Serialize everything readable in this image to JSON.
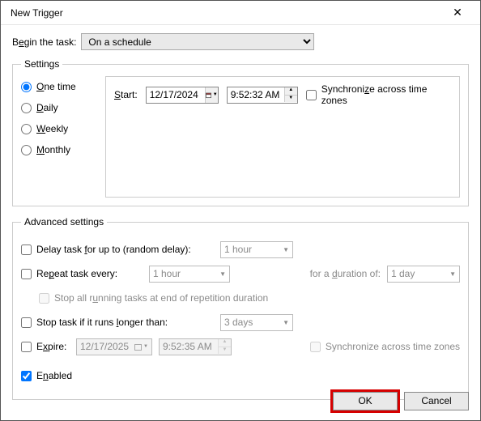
{
  "title": "New Trigger",
  "beginLabelPre": "B",
  "beginLabelU": "e",
  "beginLabelPost": "gin the task:",
  "beginValue": "On a schedule",
  "settingsLegend": "Settings",
  "radios": {
    "once": {
      "u": "O",
      "rest": "ne time"
    },
    "daily": {
      "u": "D",
      "rest": "aily"
    },
    "weekly": {
      "u": "W",
      "rest": "eekly"
    },
    "monthly": {
      "u": "M",
      "rest": "onthly"
    }
  },
  "startLabel": {
    "u": "S",
    "rest": "tart:"
  },
  "startDate": "12/17/2024",
  "startTime": "9:52:32 AM",
  "syncLabel": {
    "pre": "Synchroni",
    "u": "z",
    "post": "e across time zones"
  },
  "advLegend": "Advanced settings",
  "delay": {
    "pre": "Delay task ",
    "u": "f",
    "post": "or up to (random delay):",
    "value": "1 hour"
  },
  "repeat": {
    "pre": "Re",
    "u": "p",
    "post": "eat task every:",
    "value": "1 hour",
    "durLabelPre": "for a ",
    "durLabelU": "d",
    "durLabelPost": "uration of:",
    "durValue": "1 day"
  },
  "stopAllPre": "Stop all r",
  "stopAllU": "u",
  "stopAllPost": "nning tasks at end of repetition duration",
  "stopLong": {
    "pre": "Stop task if it runs ",
    "u": "l",
    "post": "onger than:",
    "value": "3 days"
  },
  "expire": {
    "pre": "E",
    "u": "x",
    "post": "pire:",
    "date": "12/17/2025",
    "time": "9:52:35 AM"
  },
  "syncExpire": "Synchronize across time zones",
  "enabled": {
    "pre": "E",
    "u": "n",
    "post": "abled"
  },
  "okLabel": "OK",
  "cancelLabel": "Cancel"
}
